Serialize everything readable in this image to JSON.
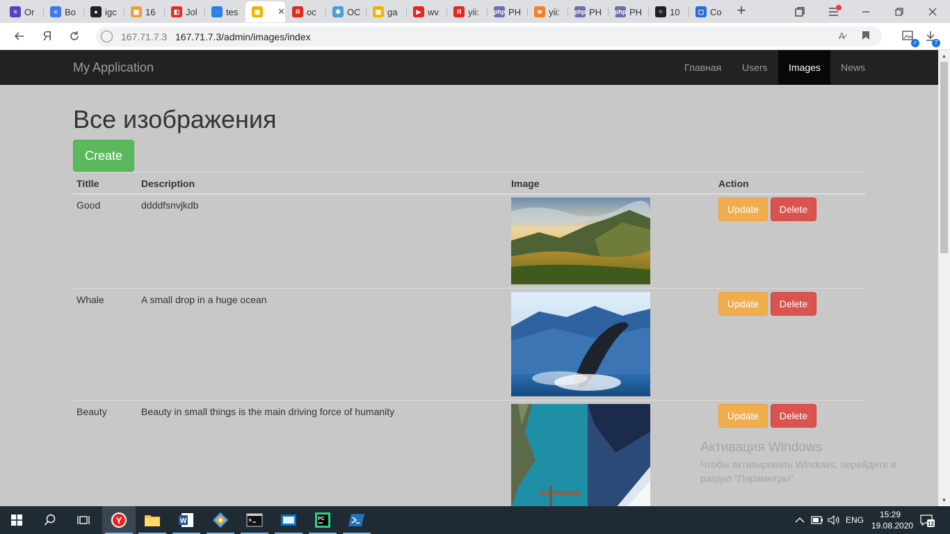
{
  "browser": {
    "tabs": [
      {
        "title": "Or",
        "color": "#5c3fc4",
        "glyph": "≡"
      },
      {
        "title": "Bo",
        "color": "#3d7be8",
        "glyph": "≡"
      },
      {
        "title": "igc",
        "color": "#222222",
        "glyph": "●"
      },
      {
        "title": "16",
        "color": "#e8a23d",
        "glyph": "▦"
      },
      {
        "title": "Jol",
        "color": "#d93025",
        "glyph": "◧"
      },
      {
        "title": "tes",
        "color": "#2b7de9",
        "glyph": "◌"
      },
      {
        "title": "",
        "color": "#f2b200",
        "glyph": "▦",
        "active": true
      },
      {
        "title": "oc",
        "color": "#e52620",
        "glyph": "Я"
      },
      {
        "title": "OC",
        "color": "#4a9fd8",
        "glyph": "✱"
      },
      {
        "title": "ga",
        "color": "#f2b200",
        "glyph": "▦"
      },
      {
        "title": "wv",
        "color": "#e52620",
        "glyph": "▶"
      },
      {
        "title": "yii:",
        "color": "#e52620",
        "glyph": "Я"
      },
      {
        "title": "PH",
        "color": "#6c6fa8",
        "glyph": "php"
      },
      {
        "title": "yii:",
        "color": "#f48024",
        "glyph": "≋"
      },
      {
        "title": "PH",
        "color": "#6c6fa8",
        "glyph": "php"
      },
      {
        "title": "PH",
        "color": "#6c6fa8",
        "glyph": "php"
      },
      {
        "title": "10",
        "color": "#222222",
        "glyph": "⁘"
      },
      {
        "title": "Co",
        "color": "#2b6cd8",
        "glyph": "▢"
      }
    ],
    "address": {
      "host": "167.71.7.3",
      "url": "167.71.7.3/admin/images/index"
    },
    "downloads_count": "7"
  },
  "app": {
    "brand": "My Application",
    "nav": [
      {
        "label": "Главная",
        "active": false
      },
      {
        "label": "Users",
        "active": false
      },
      {
        "label": "Images",
        "active": true
      },
      {
        "label": "News",
        "active": false
      }
    ],
    "page_title": "Все изображения",
    "create_label": "Create",
    "table": {
      "headers": [
        "Titlle",
        "Description",
        "Image",
        "Action"
      ],
      "rows": [
        {
          "title": "Good",
          "description": "ddddfsnvjkdb",
          "image": "mountain-landscape",
          "update": "Update",
          "delete": "Delete"
        },
        {
          "title": "Whale",
          "description": "A small drop in a huge ocean",
          "image": "whale-jumping",
          "update": "Update",
          "delete": "Delete"
        },
        {
          "title": "Beauty",
          "description": "Beauty in small things is the main driving force of humanity",
          "image": "lake-landscape",
          "update": "Update",
          "delete": "Delete"
        }
      ]
    }
  },
  "watermark": {
    "title": "Активация Windows",
    "text": "Чтобы активировать Windows, перейдите в раздел \"Параметры\"."
  },
  "taskbar": {
    "lang": "ENG",
    "time": "15:29",
    "date": "19.08.2020",
    "notifications": "12"
  }
}
